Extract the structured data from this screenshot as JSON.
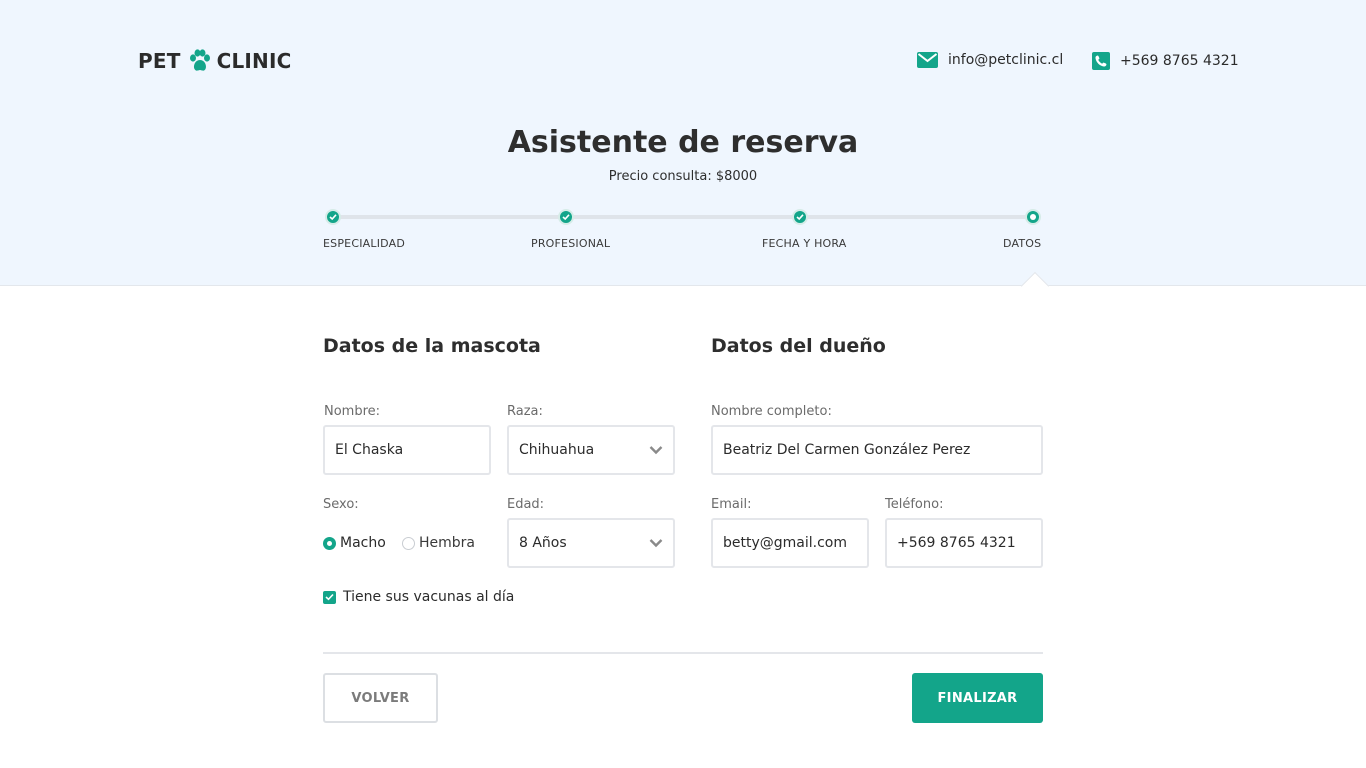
{
  "header": {
    "logo_left": "PET",
    "logo_right": "CLINIC",
    "email": "info@petclinic.cl",
    "phone": "+569 8765 4321",
    "email_icon": "envelope-icon",
    "phone_icon": "phone-icon",
    "logo_icon": "paw-icon"
  },
  "wizard": {
    "title": "Asistente de reserva",
    "price": "Precio consulta: $8000",
    "steps": [
      {
        "label": "ESPECIALIDAD",
        "status": "completed"
      },
      {
        "label": "PROFESIONAL",
        "status": "completed"
      },
      {
        "label": "FECHA Y HORA",
        "status": "completed"
      },
      {
        "label": "DATOS",
        "status": "current"
      }
    ]
  },
  "pet": {
    "section_title": "Datos de la mascota",
    "name_label": "Nombre:",
    "name_value": "El Chaska",
    "breed_label": "Raza:",
    "breed_value": "Chihuahua",
    "sex_label": "Sexo:",
    "sex_options": [
      "Macho",
      "Hembra"
    ],
    "sex_selected": "Macho",
    "age_label": "Edad:",
    "age_value": "8 Años",
    "vaccines_label": "Tiene sus vacunas al día",
    "vaccines_checked": true
  },
  "owner": {
    "section_title": "Datos del dueño",
    "fullname_label": "Nombre completo:",
    "fullname_value": "Beatriz Del Carmen González Perez",
    "email_label": "Email:",
    "email_value": "betty@gmail.com",
    "phone_label": "Teléfono:",
    "phone_value": "+569 8765 4321"
  },
  "actions": {
    "back_label": "VOLVER",
    "finish_label": "FINALIZAR"
  },
  "colors": {
    "accent": "#13a58a",
    "hero_background": "#eff6fe",
    "text": "#2b2b2b",
    "border": "#e4e6ea"
  }
}
